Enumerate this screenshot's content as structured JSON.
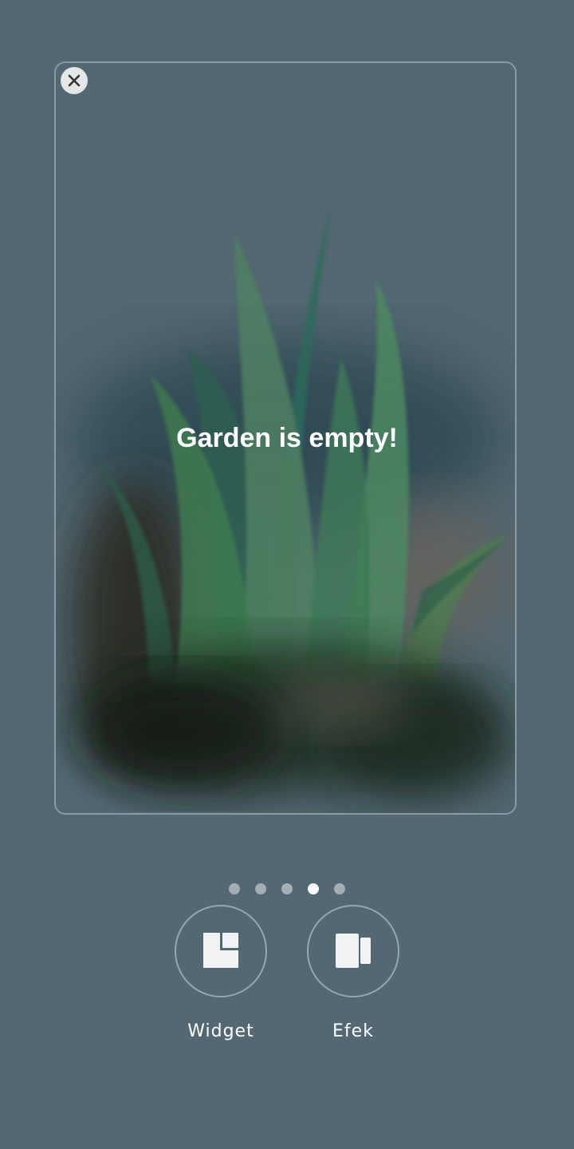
{
  "preview": {
    "empty_message": "Garden is empty!",
    "close_icon": "close-icon"
  },
  "pagination": {
    "total": 5,
    "active_index": 3
  },
  "actions": [
    {
      "label": "Widget",
      "icon": "widget-icon"
    },
    {
      "label": "Efek",
      "icon": "effects-icon"
    }
  ],
  "colors": {
    "background": "#536872",
    "card_border": "#8a9aa2",
    "dot_inactive": "#a5aeb2",
    "dot_active": "#ffffff"
  }
}
